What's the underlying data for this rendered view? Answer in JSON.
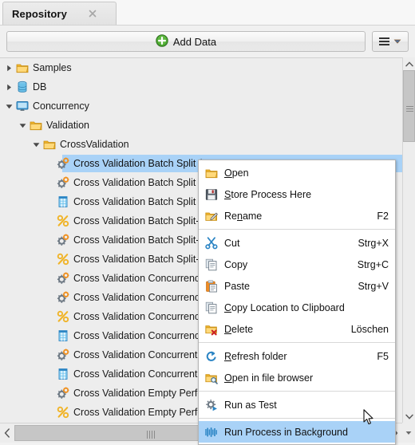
{
  "window": {
    "tab_title": "Repository",
    "close_icon": "close-icon"
  },
  "toolbar": {
    "add_data_label": "Add Data",
    "add_data_icon": "green-plus-icon",
    "menu_button_icon": "hamburger-icon",
    "menu_button_caret": "chevron-down-icon"
  },
  "tree": {
    "items": [
      {
        "label": "Samples",
        "icon": "folder-icon",
        "depth": 0,
        "arrow": "collapsed",
        "selected": false
      },
      {
        "label": "DB",
        "icon": "database-icon",
        "depth": 0,
        "arrow": "collapsed",
        "selected": false
      },
      {
        "label": "Concurrency",
        "icon": "monitor-icon",
        "depth": 0,
        "arrow": "expanded",
        "selected": false
      },
      {
        "label": "Validation",
        "icon": "folder-icon",
        "depth": 1,
        "arrow": "expanded",
        "selected": false
      },
      {
        "label": "CrossValidation",
        "icon": "folder-icon",
        "depth": 2,
        "arrow": "expanded",
        "selected": false
      },
      {
        "label": "Cross Validation Batch Split (",
        "icon": "process-icon",
        "depth": 3,
        "arrow": "none",
        "selected": true
      },
      {
        "label": "Cross Validation Batch Split B",
        "icon": "process-icon",
        "depth": 3,
        "arrow": "none",
        "selected": false
      },
      {
        "label": "Cross Validation Batch Split B",
        "icon": "data-icon",
        "depth": 3,
        "arrow": "none",
        "selected": false
      },
      {
        "label": "Cross Validation Batch Split-",
        "icon": "result-icon",
        "depth": 3,
        "arrow": "none",
        "selected": false
      },
      {
        "label": "Cross Validation Batch Split-s",
        "icon": "process-icon",
        "depth": 3,
        "arrow": "none",
        "selected": false
      },
      {
        "label": "Cross Validation Batch Split-s",
        "icon": "result-icon",
        "depth": 3,
        "arrow": "none",
        "selected": false
      },
      {
        "label": "Cross Validation Concurrenc",
        "icon": "process-icon",
        "depth": 3,
        "arrow": "none",
        "selected": false
      },
      {
        "label": "Cross Validation Concurrenc",
        "icon": "process-icon",
        "depth": 3,
        "arrow": "none",
        "selected": false
      },
      {
        "label": "Cross Validation Concurrenc",
        "icon": "result-icon",
        "depth": 3,
        "arrow": "none",
        "selected": false
      },
      {
        "label": "Cross Validation Concurrenc",
        "icon": "data-icon",
        "depth": 3,
        "arrow": "none",
        "selected": false
      },
      {
        "label": "Cross Validation Concurrent",
        "icon": "process-icon",
        "depth": 3,
        "arrow": "none",
        "selected": false
      },
      {
        "label": "Cross Validation Concurrent",
        "icon": "data-icon",
        "depth": 3,
        "arrow": "none",
        "selected": false
      },
      {
        "label": "Cross Validation Empty Perfo",
        "icon": "process-icon",
        "depth": 3,
        "arrow": "none",
        "selected": false
      },
      {
        "label": "Cross Validation Empty Perfo",
        "icon": "result-icon",
        "depth": 3,
        "arrow": "none",
        "selected": false
      }
    ]
  },
  "context_menu": {
    "items": [
      {
        "label": "Open",
        "accel": "",
        "icon": "folder-open-icon",
        "mnemonic": "O",
        "separator_after": false,
        "highlighted": false
      },
      {
        "label": "Store Process Here",
        "accel": "",
        "icon": "save-icon",
        "mnemonic": "S",
        "separator_after": false,
        "highlighted": false
      },
      {
        "label": "Rename",
        "accel": "F2",
        "icon": "rename-icon",
        "mnemonic": "n",
        "separator_after": true,
        "highlighted": false
      },
      {
        "label": "Cut",
        "accel": "Strg+X",
        "icon": "scissors-icon",
        "mnemonic": "",
        "separator_after": false,
        "highlighted": false
      },
      {
        "label": "Copy",
        "accel": "Strg+C",
        "icon": "copy-icon",
        "mnemonic": "",
        "separator_after": false,
        "highlighted": false
      },
      {
        "label": "Paste",
        "accel": "Strg+V",
        "icon": "paste-icon",
        "mnemonic": "",
        "separator_after": false,
        "highlighted": false
      },
      {
        "label": "Copy Location to Clipboard",
        "accel": "",
        "icon": "copy-location-icon",
        "mnemonic": "C",
        "separator_after": false,
        "highlighted": false
      },
      {
        "label": "Delete",
        "accel": "Löschen",
        "icon": "delete-folder-icon",
        "mnemonic": "D",
        "separator_after": true,
        "highlighted": false
      },
      {
        "label": "Refresh folder",
        "accel": "F5",
        "icon": "refresh-icon",
        "mnemonic": "R",
        "separator_after": false,
        "highlighted": false
      },
      {
        "label": "Open in file browser",
        "accel": "",
        "icon": "folder-search-icon",
        "mnemonic": "O",
        "separator_after": true,
        "highlighted": false
      },
      {
        "label": "Run as Test",
        "accel": "",
        "icon": "gear-play-icon",
        "mnemonic": "",
        "separator_after": true,
        "highlighted": false
      },
      {
        "label": "Run Process in Background",
        "accel": "",
        "icon": "background-run-icon",
        "mnemonic": "",
        "separator_after": false,
        "highlighted": true
      }
    ]
  },
  "scrollbars": {
    "vertical_up_icon": "chevron-up-icon",
    "vertical_down_icon": "chevron-down-icon",
    "horizontal_left_icon": "chevron-left-icon",
    "horizontal_right_icon": "chevron-right-icon"
  },
  "cursor": {
    "icon": "mouse-pointer-icon"
  },
  "colors": {
    "selection": "#a9d2f7",
    "accent_green": "#3f9c35",
    "panel_bg": "#ededed",
    "menu_bg": "#ffffff",
    "folder": "#f5c344",
    "icon_blue": "#2e8fd4"
  }
}
